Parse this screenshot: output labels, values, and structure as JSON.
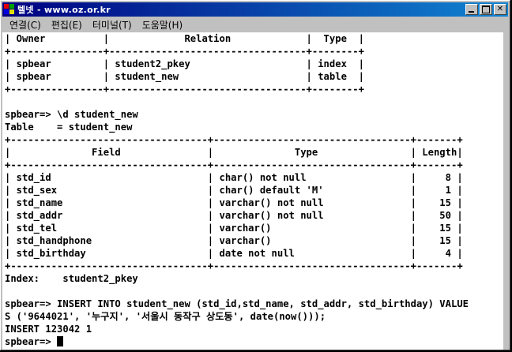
{
  "window": {
    "title": "텔넷 - www.oz.or.kr",
    "title_bar_color": "#000080",
    "terminal_bg": "#ffffff",
    "terminal_fg": "#000000"
  },
  "menu": [
    "연결(C)",
    "편집(E)",
    "터미널(T)",
    "도움말(H)"
  ],
  "terminal_lines": [
    "| Owner          |             Relation             |  Type  |",
    "+----------------+----------------------------------+--------+",
    "| spbear         | student2_pkey                    | index  |",
    "| spbear         | student_new                      | table  |",
    "+----------------+----------------------------------+--------+",
    "",
    "spbear=> \\d student_new",
    "Table    = student_new",
    "+----------------------------------+----------------------------------+-------+",
    "|              Field               |              Type                | Length|",
    "+----------------------------------+----------------------------------+-------+",
    "| std_id                           | char() not null                  |     8 |",
    "| std_sex                          | char() default 'M'               |     1 |",
    "| std_name                         | varchar() not null               |    15 |",
    "| std_addr                         | varchar() not null               |    50 |",
    "| std_tel                          | varchar()                        |    15 |",
    "| std_handphone                    | varchar()                        |    15 |",
    "| std_birthday                     | date not null                    |     4 |",
    "+----------------------------------+----------------------------------+-------+",
    "Index:    student2_pkey",
    "",
    "spbear=> INSERT INTO student_new (std_id,std_name, std_addr, std_birthday) VALUE",
    "S ('9644021', '누구지', '서울시 동작구 상도동', date(now()));",
    "INSERT 123042 1",
    "spbear=> "
  ]
}
